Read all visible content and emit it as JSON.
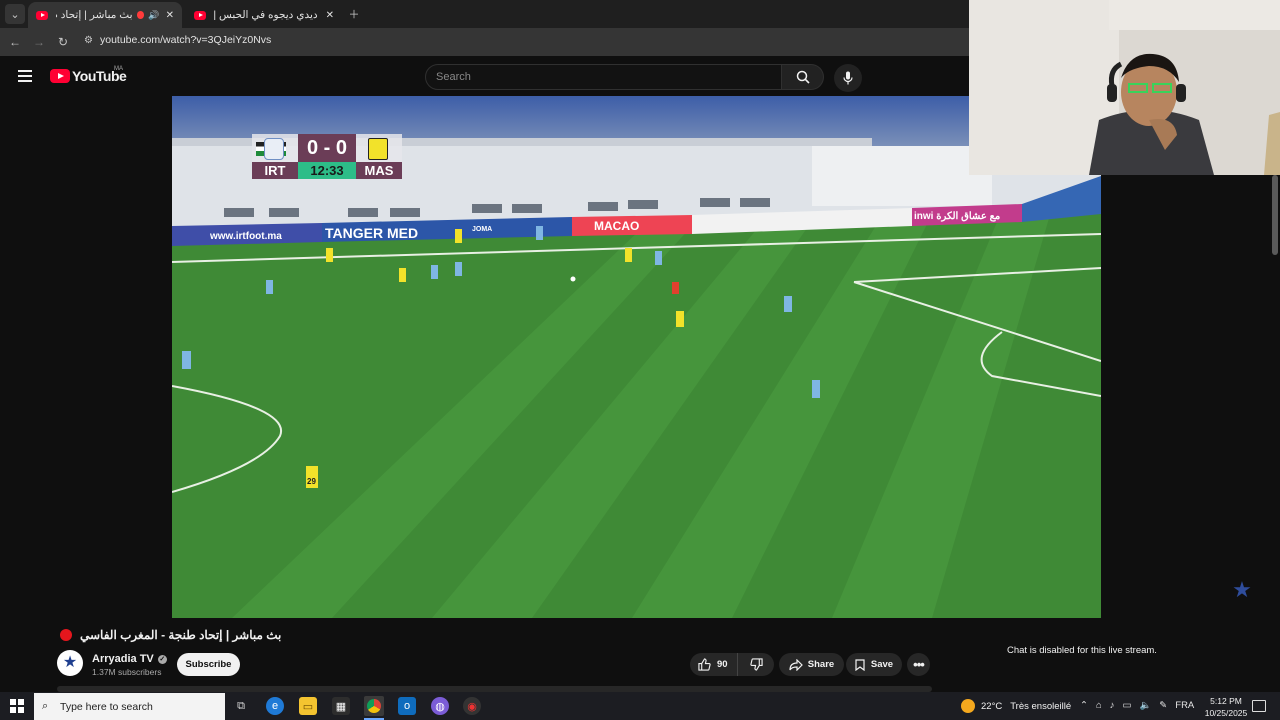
{
  "browser": {
    "tabs": [
      {
        "title": "بث مباشر | إتحاد طنجة",
        "active": true
      },
      {
        "title": "ديدي ديجوه في الحبس | بثث كال...",
        "active": false
      }
    ],
    "url": "youtube.com/watch?v=3QJeiYz0Nvs"
  },
  "youtube": {
    "logo_text": "YouTube",
    "country_code": "MA",
    "search_placeholder": "Search"
  },
  "scoreboard": {
    "home_team": "IRT",
    "away_team": "MAS",
    "score": "0 - 0",
    "clock": "12:33"
  },
  "ad_boards": {
    "irtfoot": "www.irtfoot.ma",
    "tanger_med": "TANGER MED",
    "macao": "MACAO",
    "inwi": "inwi مع عشاق الكرة",
    "joma": "JOMA"
  },
  "player_numbers": {
    "near_player": "29"
  },
  "video_info": {
    "title": "بث مباشر | إتحاد طنجة - المغرب الفاسي",
    "channel_name": "Arryadia TV",
    "subscribers": "1.37M subscribers",
    "subscribe_label": "Subscribe",
    "like_count": "90",
    "share_label": "Share",
    "save_label": "Save"
  },
  "chat": {
    "message": "Chat is disabled for this live stream."
  },
  "taskbar": {
    "search_placeholder": "Type here to search",
    "weather_temp": "22°C",
    "weather_desc": "Très ensoleillé",
    "language": "FRA",
    "time": "5:12 PM",
    "date": "10/25/2025"
  },
  "colors": {
    "youtube_red": "#ff0033",
    "pitch_green": "#3f8a36",
    "home_kit": "#7fb6e3",
    "away_kit": "#f2e22a",
    "score_bg": "#6b3d57",
    "clock_bg": "#2dbd88"
  }
}
